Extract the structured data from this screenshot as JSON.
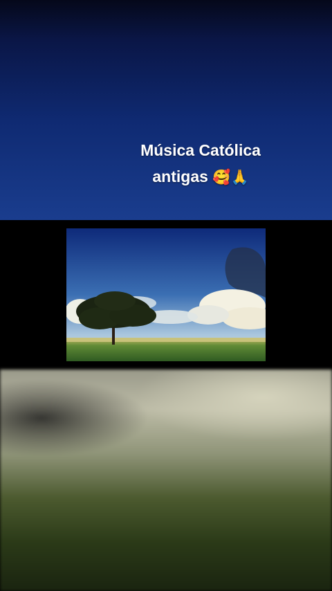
{
  "caption": {
    "line1": "Música Católica",
    "line2": "antigas",
    "emojis": "🥰🙏"
  },
  "photo": {
    "subject": "lone tree in green field under blue sky with clouds"
  },
  "colors": {
    "sky_top": "#0a1646",
    "sky_bottom": "#1a3d8e",
    "grass": "#3f6b2a",
    "background": "#000000"
  }
}
